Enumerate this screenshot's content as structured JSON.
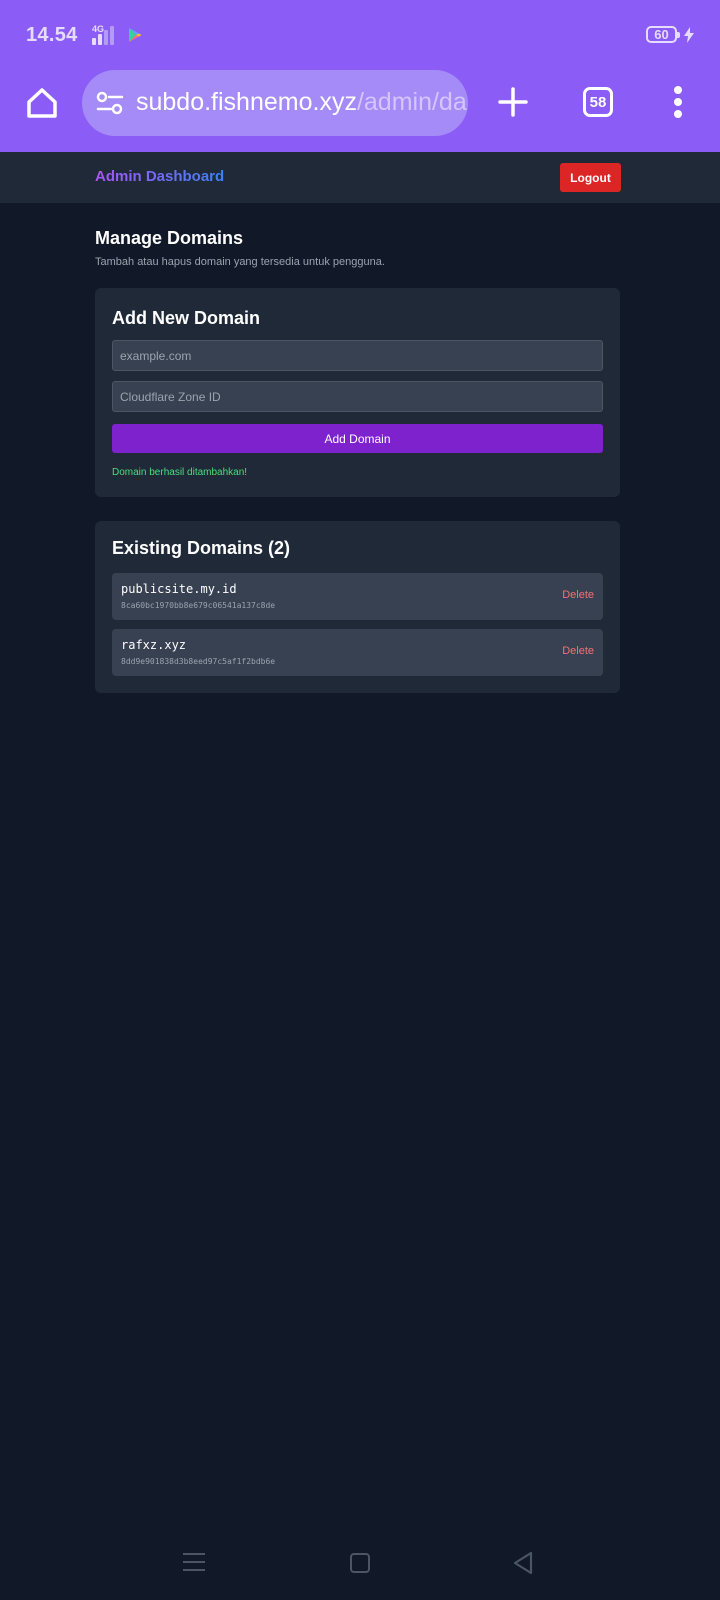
{
  "status_bar": {
    "time": "14.54",
    "network": "4G",
    "battery": "60"
  },
  "browser": {
    "url_host": "subdo.fishnemo.xyz",
    "url_path": "/admin/da",
    "tab_count": "58"
  },
  "header": {
    "title": "Admin Dashboard",
    "logout_label": "Logout",
    "title_gradient": [
      "#a855f7",
      "#3b82f6"
    ],
    "logout_color": "#dc2626"
  },
  "page": {
    "title": "Manage Domains",
    "subtitle": "Tambah atau hapus domain yang tersedia untuk pengguna."
  },
  "add_domain": {
    "title": "Add New Domain",
    "domain_placeholder": "example.com",
    "domain_value": "",
    "zone_placeholder": "Cloudflare Zone ID",
    "zone_value": "",
    "button_label": "Add Domain",
    "button_color": "#7e22ce",
    "success_message": "Domain berhasil ditambahkan!"
  },
  "existing": {
    "title": "Existing Domains (2)",
    "domains": [
      {
        "name": "publicsite.my.id",
        "zone_id": "8ca60bc1970bb8e679c06541a137c8de",
        "delete_label": "Delete"
      },
      {
        "name": "rafxz.xyz",
        "zone_id": "8dd9e901838d3b8eed97c5af1f2bdb6e",
        "delete_label": "Delete"
      }
    ]
  },
  "theme": {
    "browser_bar": "#8b5cf6",
    "page_background": "#111827",
    "card_background": "#1f2937"
  }
}
